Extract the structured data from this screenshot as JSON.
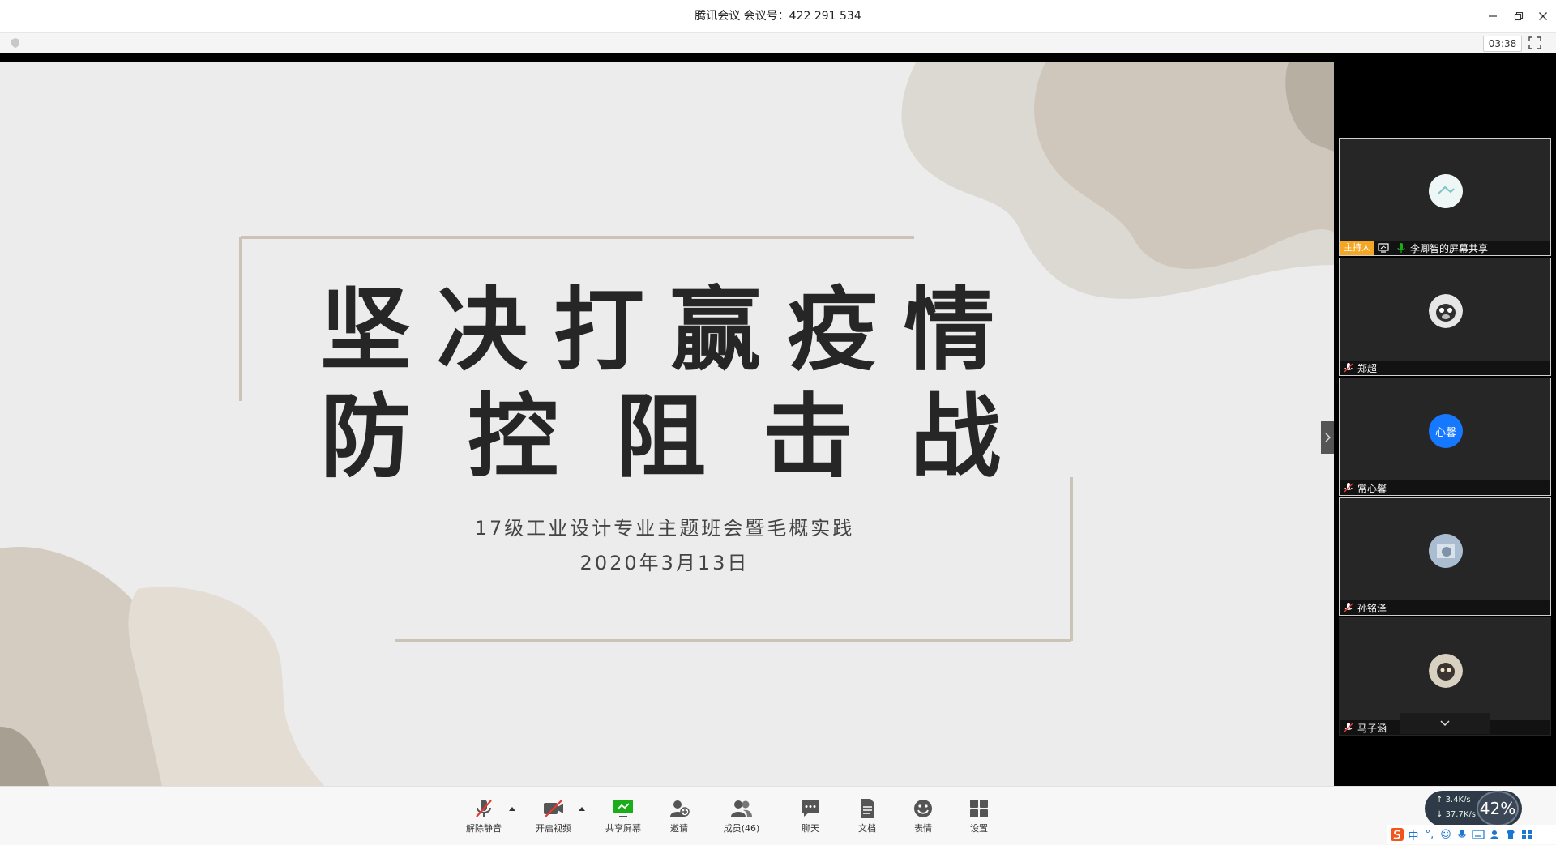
{
  "window": {
    "title": "腾讯会议 会议号：422 291 534",
    "timer": "03:38"
  },
  "slide": {
    "title_line1": "坚决打赢疫情",
    "title_line2": "防控阻击战",
    "subtitle": "17级工业设计专业主题班会暨毛概实践",
    "date": "2020年3月13日"
  },
  "participants": [
    {
      "name": "李卿智的屏幕共享",
      "tag": "主持人",
      "avatar": "landscape-avatar"
    },
    {
      "name": "郑超",
      "avatar": "dog-avatar"
    },
    {
      "name": "常心馨",
      "avatar_text": "心馨",
      "avatar_color": "#1677ff"
    },
    {
      "name": "孙铭泽",
      "avatar": "photo-avatar"
    },
    {
      "name": "马子涵",
      "avatar": "cat-avatar"
    }
  ],
  "toolbar": {
    "mute": "解除静音",
    "video": "开启视频",
    "share": "共享屏幕",
    "invite": "邀请",
    "members": "成员(46)",
    "chat": "聊天",
    "docs": "文档",
    "emoji": "表情",
    "settings": "设置"
  },
  "network": {
    "upload": "3.4K/s",
    "download": "37.7K/s",
    "percent": "42%"
  },
  "ime": {
    "lang": "中"
  },
  "colors": {
    "accent_green": "#1aad19",
    "host_tag": "#f5a623",
    "mute_red": "#e53935"
  }
}
